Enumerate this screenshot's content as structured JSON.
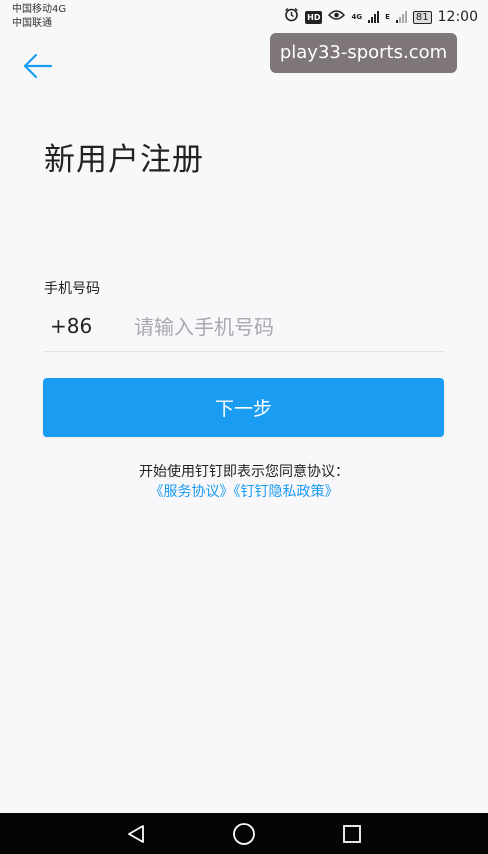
{
  "status_bar": {
    "carrier_1": "中国移动4G",
    "carrier_2": "中国联通",
    "hd_label": "HD",
    "net_label_top": "4G",
    "net_label_e": "E",
    "battery": "81",
    "time": "12:00",
    "icons": [
      "alarm-icon",
      "hd-icon",
      "eye-comfort-icon",
      "signal-icon",
      "battery-icon"
    ]
  },
  "watermark": "play33-sports.com",
  "header": {
    "back_icon": "arrow-left-icon",
    "title": "新用户注册"
  },
  "form": {
    "phone_label": "手机号码",
    "country_code": "+86",
    "phone_placeholder": "请输入手机号码",
    "phone_value": "",
    "next_label": "下一步"
  },
  "agreement": {
    "text": "开始使用钉钉即表示您同意协议：",
    "service_link": "《服务协议》",
    "privacy_link": "《钉钉隐私政策》"
  },
  "nav": {
    "icons": [
      "back-triangle-icon",
      "home-circle-icon",
      "recents-square-icon"
    ]
  },
  "colors": {
    "accent": "#1a9cf2",
    "background": "#f8f7fa",
    "nav_bar": "#050505"
  }
}
